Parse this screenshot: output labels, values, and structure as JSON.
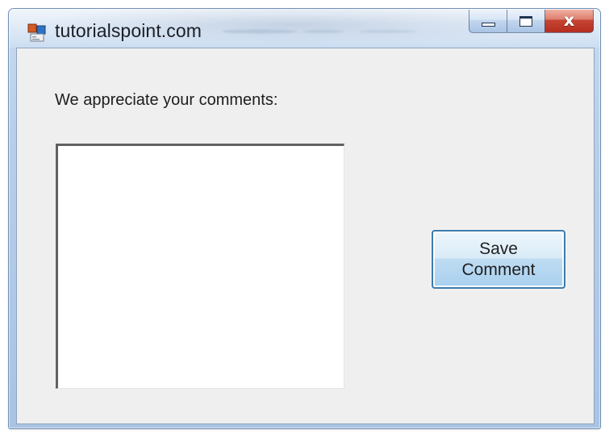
{
  "window": {
    "title": "tutorialspoint.com",
    "close_glyph": "x",
    "colors": {
      "frame": "#b8cfe9",
      "client_background": "#efefef",
      "close_button": "#c64634",
      "button_border": "#3d7bad"
    }
  },
  "icons": {
    "app": "app-icon",
    "minimize": "minimize-icon",
    "maximize": "maximize-icon",
    "close": "close-icon"
  },
  "form": {
    "label": "We appreciate your comments:",
    "textarea_value": "",
    "save_button_label": "Save\nComment"
  }
}
